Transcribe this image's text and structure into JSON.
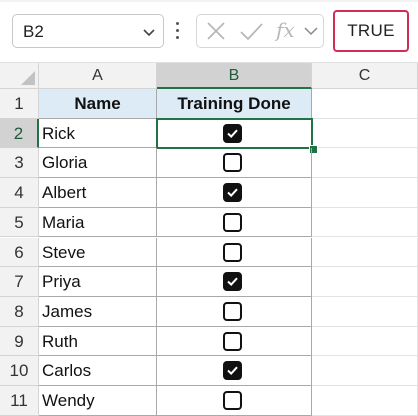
{
  "formula_bar": {
    "name_box": "B2",
    "cancel_icon": "close-icon",
    "enter_icon": "checkmark-icon",
    "function_label": "fx",
    "formula_value": "TRUE"
  },
  "grid": {
    "column_headers": [
      "A",
      "B",
      "C"
    ],
    "row_headers": [
      "1",
      "2",
      "3",
      "4",
      "5",
      "6",
      "7",
      "8",
      "9",
      "10",
      "11"
    ],
    "selected_column": "B",
    "selected_row": "2",
    "header_row": {
      "name": "Name",
      "training": "Training Done"
    },
    "rows": [
      {
        "name": "Rick",
        "done": true
      },
      {
        "name": "Gloria",
        "done": false
      },
      {
        "name": "Albert",
        "done": true
      },
      {
        "name": "Maria",
        "done": false
      },
      {
        "name": "Steve",
        "done": false
      },
      {
        "name": "Priya",
        "done": true
      },
      {
        "name": "James",
        "done": false
      },
      {
        "name": "Ruth",
        "done": false
      },
      {
        "name": "Carlos",
        "done": true
      },
      {
        "name": "Wendy",
        "done": false
      }
    ]
  },
  "colors": {
    "selection": "#217346",
    "formula_highlight": "#d22d55",
    "header_fill": "#dcebf5"
  }
}
